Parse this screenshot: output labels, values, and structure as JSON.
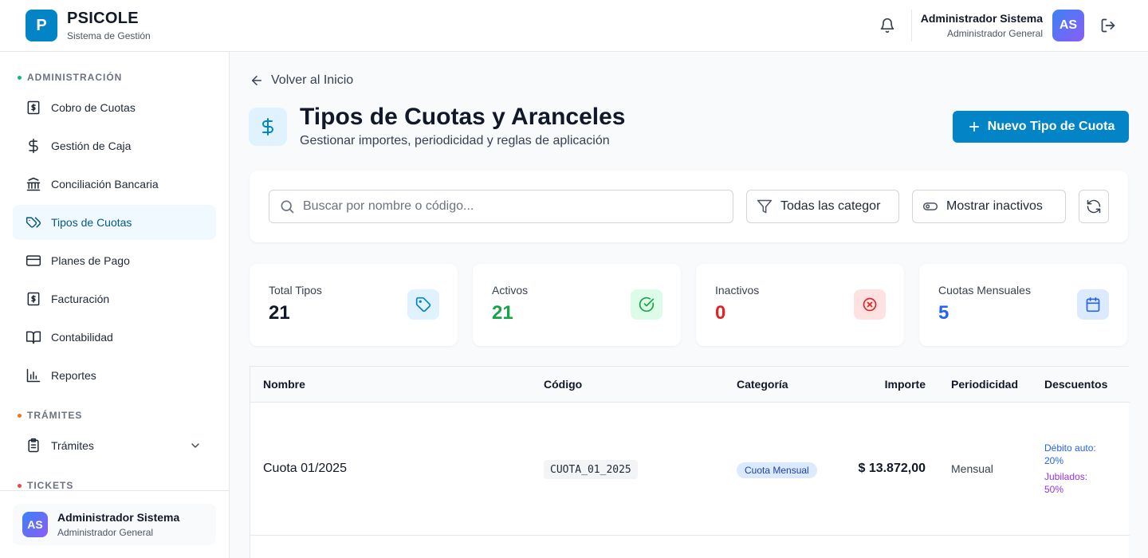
{
  "header": {
    "logo_letter": "P",
    "app_name": "PSICOLE",
    "app_subtitle": "Sistema de Gestión",
    "user_name": "Administrador Sistema",
    "user_role": "Administrador General",
    "avatar_initials": "AS"
  },
  "sidebar": {
    "sections": [
      {
        "title": "ADMINISTRACIÓN",
        "dot_color": "#10b981"
      },
      {
        "title": "TRÁMITES",
        "dot_color": "#f97316"
      },
      {
        "title": "TICKETS",
        "dot_color": "#ef4444"
      }
    ],
    "items": [
      {
        "label": "Cobro de Cuotas",
        "icon": "receipt-dollar-icon"
      },
      {
        "label": "Gestión de Caja",
        "icon": "dollar-icon"
      },
      {
        "label": "Conciliación Bancaria",
        "icon": "bank-icon"
      },
      {
        "label": "Tipos de Cuotas",
        "icon": "tags-icon",
        "active": true
      },
      {
        "label": "Planes de Pago",
        "icon": "credit-card-icon"
      },
      {
        "label": "Facturación",
        "icon": "receipt-dollar-icon"
      },
      {
        "label": "Contabilidad",
        "icon": "book-open-icon"
      },
      {
        "label": "Reportes",
        "icon": "bar-chart-icon"
      },
      {
        "label": "Trámites",
        "icon": "clipboard-list-icon"
      }
    ],
    "footer": {
      "avatar_initials": "AS",
      "name": "Administrador Sistema",
      "role": "Administrador General"
    }
  },
  "main": {
    "back_label": "Volver al Inicio",
    "title": "Tipos de Cuotas y Aranceles",
    "subtitle": "Gestionar importes, periodicidad y reglas de aplicación",
    "new_button_label": "Nuevo Tipo de Cuota",
    "filters": {
      "search_placeholder": "Buscar por nombre o código...",
      "search_value": "",
      "category_select": "Todas las categor",
      "show_inactive_label": "Mostrar inactivos"
    },
    "stats": [
      {
        "label": "Total Tipos",
        "value": "21",
        "color": "#111827",
        "icon": "tag-icon",
        "icon_bg": "#e0f2fe",
        "icon_color": "#0284c7"
      },
      {
        "label": "Activos",
        "value": "21",
        "color": "#16a34a",
        "icon": "check-circle-icon",
        "icon_bg": "#dcfce7",
        "icon_color": "#16a34a"
      },
      {
        "label": "Inactivos",
        "value": "0",
        "color": "#dc2626",
        "icon": "x-circle-icon",
        "icon_bg": "#fee2e2",
        "icon_color": "#dc2626"
      },
      {
        "label": "Cuotas Mensuales",
        "value": "5",
        "color": "#2563eb",
        "icon": "calendar-icon",
        "icon_bg": "#dbeafe",
        "icon_color": "#2563eb"
      }
    ],
    "table": {
      "columns": [
        "Nombre",
        "Código",
        "Categoría",
        "Importe",
        "Periodicidad",
        "Descuentos"
      ],
      "rows": [
        {
          "nombre": "Cuota 01/2025",
          "codigo": "CUOTA_01_2025",
          "categoria": "Cuota Mensual",
          "importe": "$ 13.872,00",
          "periodicidad": "Mensual",
          "descuentos": [
            {
              "label": "Débito auto:",
              "value": "20%",
              "color": "#2563eb"
            },
            {
              "label": "Jubilados:",
              "value": "50%",
              "color": "#9333ea"
            }
          ]
        }
      ]
    }
  }
}
